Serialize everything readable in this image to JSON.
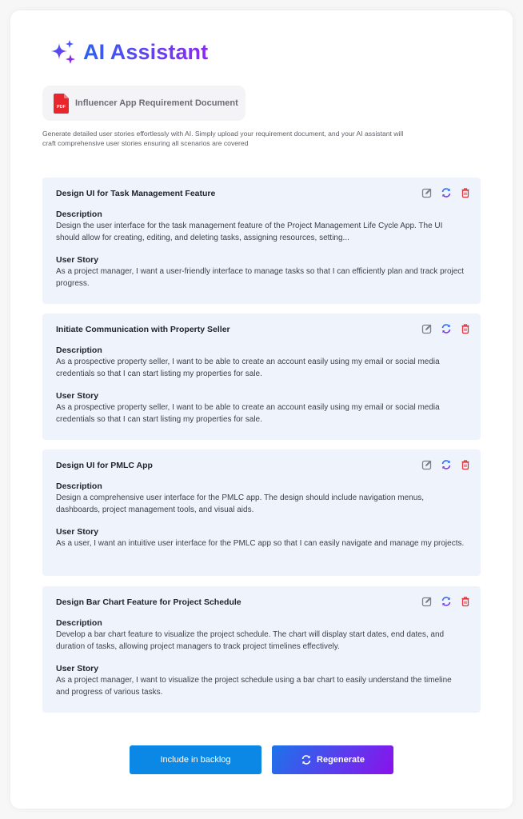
{
  "header": {
    "title": "AI Assistant",
    "icon": "sparkles-icon"
  },
  "file": {
    "name": "Influencer App Requirement Document",
    "icon": "pdf-file-icon",
    "badge": "PDF"
  },
  "intro": "Generate detailed user stories effortlessly with AI. Simply upload your requirement document, and your AI assistant will craft comprehensive user stories ensuring all scenarios are covered",
  "labels": {
    "description": "Description",
    "user_story": "User Story"
  },
  "stories": [
    {
      "title": "Design UI for Task Management Feature",
      "description": "Design the user interface for the task management feature of the Project Management Life Cycle App. The UI should allow for creating, editing, and deleting tasks, assigning resources, setting...",
      "user_story": "As a project manager, I want a user-friendly interface to manage tasks so that I can efficiently plan and track project progress."
    },
    {
      "title": "Initiate Communication with Property Seller",
      "description": "As a prospective property seller, I want to be able to create an account easily using my email or social media credentials so that I can start listing my properties for sale.",
      "user_story": "As a prospective property seller, I want to be able to create an account easily using my email or social media credentials so that I can start listing my properties for sale."
    },
    {
      "title": "Design UI for PMLC App",
      "description": "Design a comprehensive user interface for the PMLC app. The design should include navigation menus, dashboards, project management tools, and visual aids.",
      "user_story": "As a user, I want an intuitive user interface for the PMLC app so that I can easily navigate and manage my projects."
    },
    {
      "title": "Design Bar Chart Feature for Project Schedule",
      "description": "Develop a bar chart feature to visualize the project schedule. The chart will display start dates, end dates, and duration of tasks, allowing project managers to track project timelines effectively.",
      "user_story": "As a project manager, I want to visualize the project schedule using a bar chart to easily understand the timeline and progress of various tasks."
    }
  ],
  "actions": {
    "icons": [
      "edit-icon",
      "regenerate-icon",
      "delete-icon"
    ]
  },
  "buttons": {
    "backlog": "Include in backlog",
    "regenerate": "Regenerate"
  },
  "colors": {
    "accent_blue": "#0b88e6",
    "gradient_start": "#1c74ea",
    "gradient_end": "#8a12ec",
    "delete_red": "#e0353b",
    "card_bg": "#eff3fc"
  }
}
